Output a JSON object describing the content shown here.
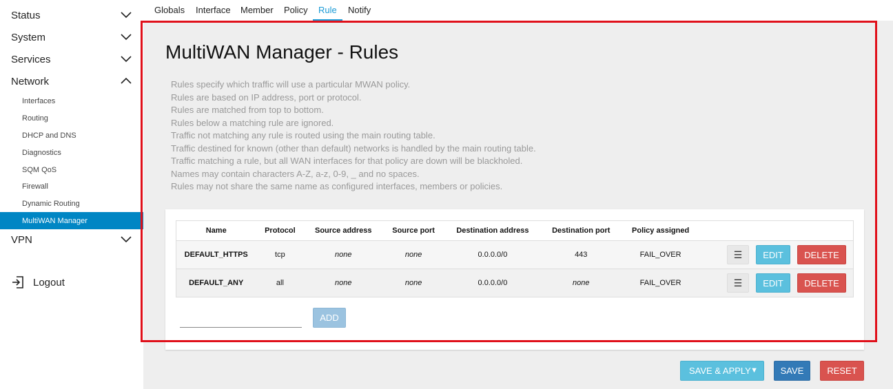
{
  "sidebar": {
    "menus": [
      {
        "label": "Status",
        "expanded": false
      },
      {
        "label": "System",
        "expanded": false
      },
      {
        "label": "Services",
        "expanded": false
      },
      {
        "label": "Network",
        "expanded": true
      }
    ],
    "network_items": [
      "Interfaces",
      "Routing",
      "DHCP and DNS",
      "Diagnostics",
      "SQM QoS",
      "Firewall",
      "Dynamic Routing",
      "MultiWAN Manager"
    ],
    "active_item": "MultiWAN Manager",
    "vpn_label": "VPN",
    "logout_label": "Logout"
  },
  "tabs": [
    "Globals",
    "Interface",
    "Member",
    "Policy",
    "Rule",
    "Notify"
  ],
  "active_tab": "Rule",
  "page": {
    "title": "MultiWAN Manager - Rules",
    "description": [
      "Rules specify which traffic will use a particular MWAN policy.",
      "Rules are based on IP address, port or protocol.",
      "Rules are matched from top to bottom.",
      "Rules below a matching rule are ignored.",
      "Traffic not matching any rule is routed using the main routing table.",
      "Traffic destined for known (other than default) networks is handled by the main routing table.",
      "Traffic matching a rule, but all WAN interfaces for that policy are down will be blackholed.",
      "Names may contain characters A-Z, a-z, 0-9, _ and no spaces.",
      "Rules may not share the same name as configured interfaces, members or policies."
    ]
  },
  "table": {
    "headers": [
      "Name",
      "Protocol",
      "Source address",
      "Source port",
      "Destination address",
      "Destination port",
      "Policy assigned"
    ],
    "rows": [
      {
        "name": "DEFAULT_HTTPS",
        "protocol": "tcp",
        "src_addr": "none",
        "src_port": "none",
        "dest_addr": "0.0.0.0/0",
        "dest_port": "443",
        "policy": "FAIL_OVER"
      },
      {
        "name": "DEFAULT_ANY",
        "protocol": "all",
        "src_addr": "none",
        "src_port": "none",
        "dest_addr": "0.0.0.0/0",
        "dest_port": "none",
        "policy": "FAIL_OVER"
      }
    ],
    "menu_glyph": "☰",
    "edit_label": "EDIT",
    "delete_label": "DELETE"
  },
  "add": {
    "input_value": "",
    "button_label": "ADD"
  },
  "footer": {
    "save_apply_label": "SAVE & APPLY",
    "save_label": "SAVE",
    "reset_label": "RESET"
  }
}
